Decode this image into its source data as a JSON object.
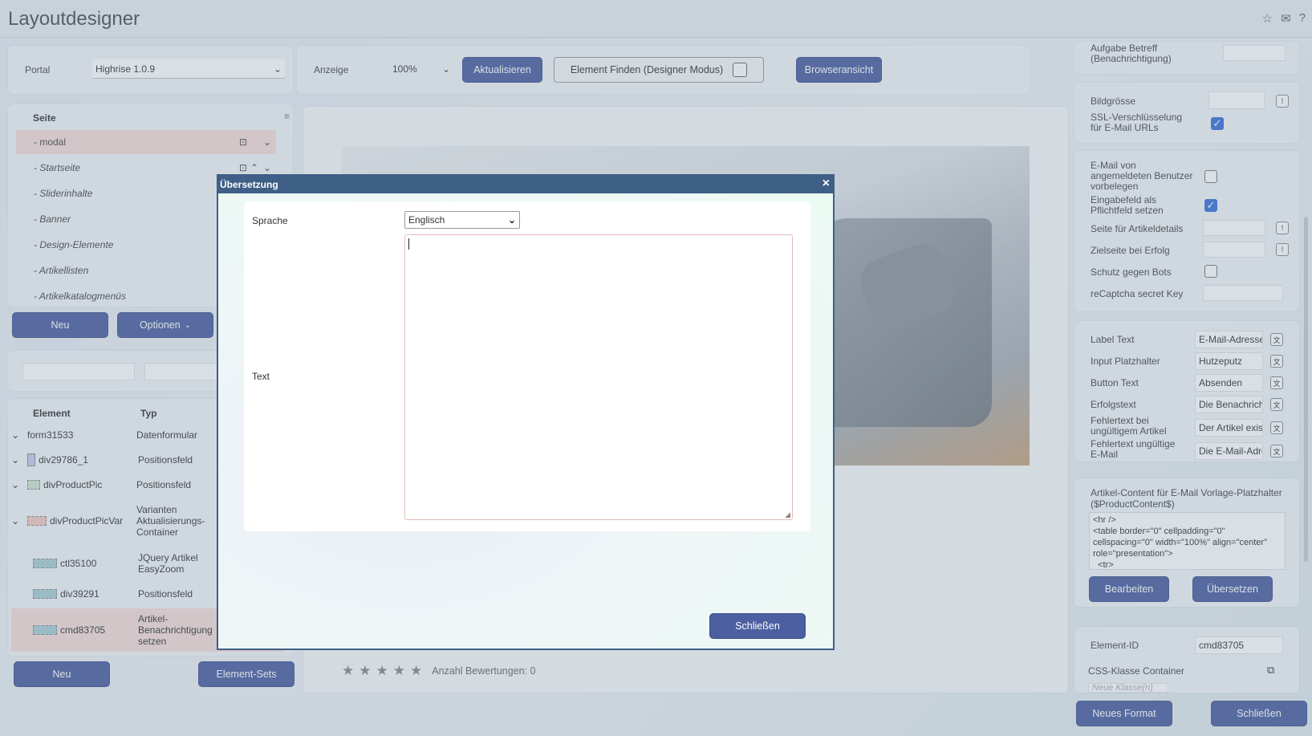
{
  "app": {
    "title": "Layoutdesigner"
  },
  "toolbar": {
    "portal_label": "Portal",
    "portal_value": "Highrise 1.0.9",
    "anzeige_label": "Anzeige",
    "zoom_value": "100%",
    "refresh_label": "Aktualisieren",
    "find_element_label": "Element Finden (Designer Modus)",
    "browser_view_label": "Browseransicht"
  },
  "page_tree": {
    "header": "Seite",
    "items": [
      {
        "label": "- modal"
      },
      {
        "label": "- Startseite"
      },
      {
        "label": "- Sliderinhalte"
      },
      {
        "label": "- Banner"
      },
      {
        "label": "- Design-Elemente"
      },
      {
        "label": "- Artikellisten"
      },
      {
        "label": "- Artikelkatalogmenüs"
      }
    ],
    "new_button": "Neu",
    "options_button": "Optionen"
  },
  "elements": {
    "col_element": "Element",
    "col_type": "Typ",
    "rows": [
      {
        "name": "form31533",
        "type": "Datenformular"
      },
      {
        "name": "div29786_1",
        "type": "Positionsfeld"
      },
      {
        "name": "divProductPic",
        "type": "Positionsfeld"
      },
      {
        "name": "divProductPicVar",
        "type": "Varianten Aktualisierungs-Container"
      },
      {
        "name": "ctl35100",
        "type": "JQuery Artikel EasyZoom"
      },
      {
        "name": "div39291",
        "type": "Positionsfeld"
      },
      {
        "name": "cmd83705",
        "type": "Artikel-Benachrichtigung setzen"
      }
    ],
    "new_button": "Neu",
    "sets_button": "Element-Sets"
  },
  "preview": {
    "rating_text": "Anzahl Bewertungen: 0",
    "stars": 5
  },
  "properties": {
    "top_partial": "Aufgabe Betreff (Benachrichtigung)",
    "bildgroesse_label": "Bildgrösse",
    "ssl_label": "SSL-Verschlüsselung für E-Mail URLs",
    "email_prefill_label": "E-Mail von angemeldeten Benutzer vorbelegen",
    "required_label": "Eingabefeld als Pflichtfeld setzen",
    "article_page_label": "Seite für Artikeldetails",
    "target_page_label": "Zielseite bei Erfolg",
    "bot_protect_label": "Schutz gegen Bots",
    "recaptcha_label": "reCaptcha secret Key",
    "label_text_label": "Label Text",
    "label_text_value": "E-Mail-Adresse",
    "placeholder_label": "Input Platzhalter",
    "placeholder_value": "Hutzeputz",
    "button_text_label": "Button Text",
    "button_text_value": "Absenden",
    "success_label": "Erfolgstext",
    "success_value": "Die Benachrich",
    "err_article_label": "Fehlertext bei ungültigem Artikel",
    "err_article_value": "Der Artikel exis",
    "err_email_label": "Fehlertext ungültige E-Mail",
    "err_email_value": "Die E-Mail-Adre",
    "content_label": "Artikel-Content für E-Mail Vorlage-Platzhalter ($ProductContent$)",
    "content_value": "<hr />\n<table border=\"0\" cellpadding=\"0\" cellspacing=\"0\" width=\"100%\" align=\"center\" role=\"presentation\">\n  <tr>",
    "edit_button": "Bearbeiten",
    "translate_button": "Übersetzen",
    "element_id_label": "Element-ID",
    "element_id_value": "cmd83705",
    "css_class_label": "CSS-Klasse Container",
    "css_class_placeholder": "Neue Klasse(n)",
    "new_format_button": "Neues Format",
    "close_button": "Schließen"
  },
  "dialog": {
    "title": "Übersetzung",
    "close_x": "×",
    "language_label": "Sprache",
    "language_value": "Englisch",
    "text_label": "Text",
    "text_value": "",
    "close_button": "Schließen"
  }
}
